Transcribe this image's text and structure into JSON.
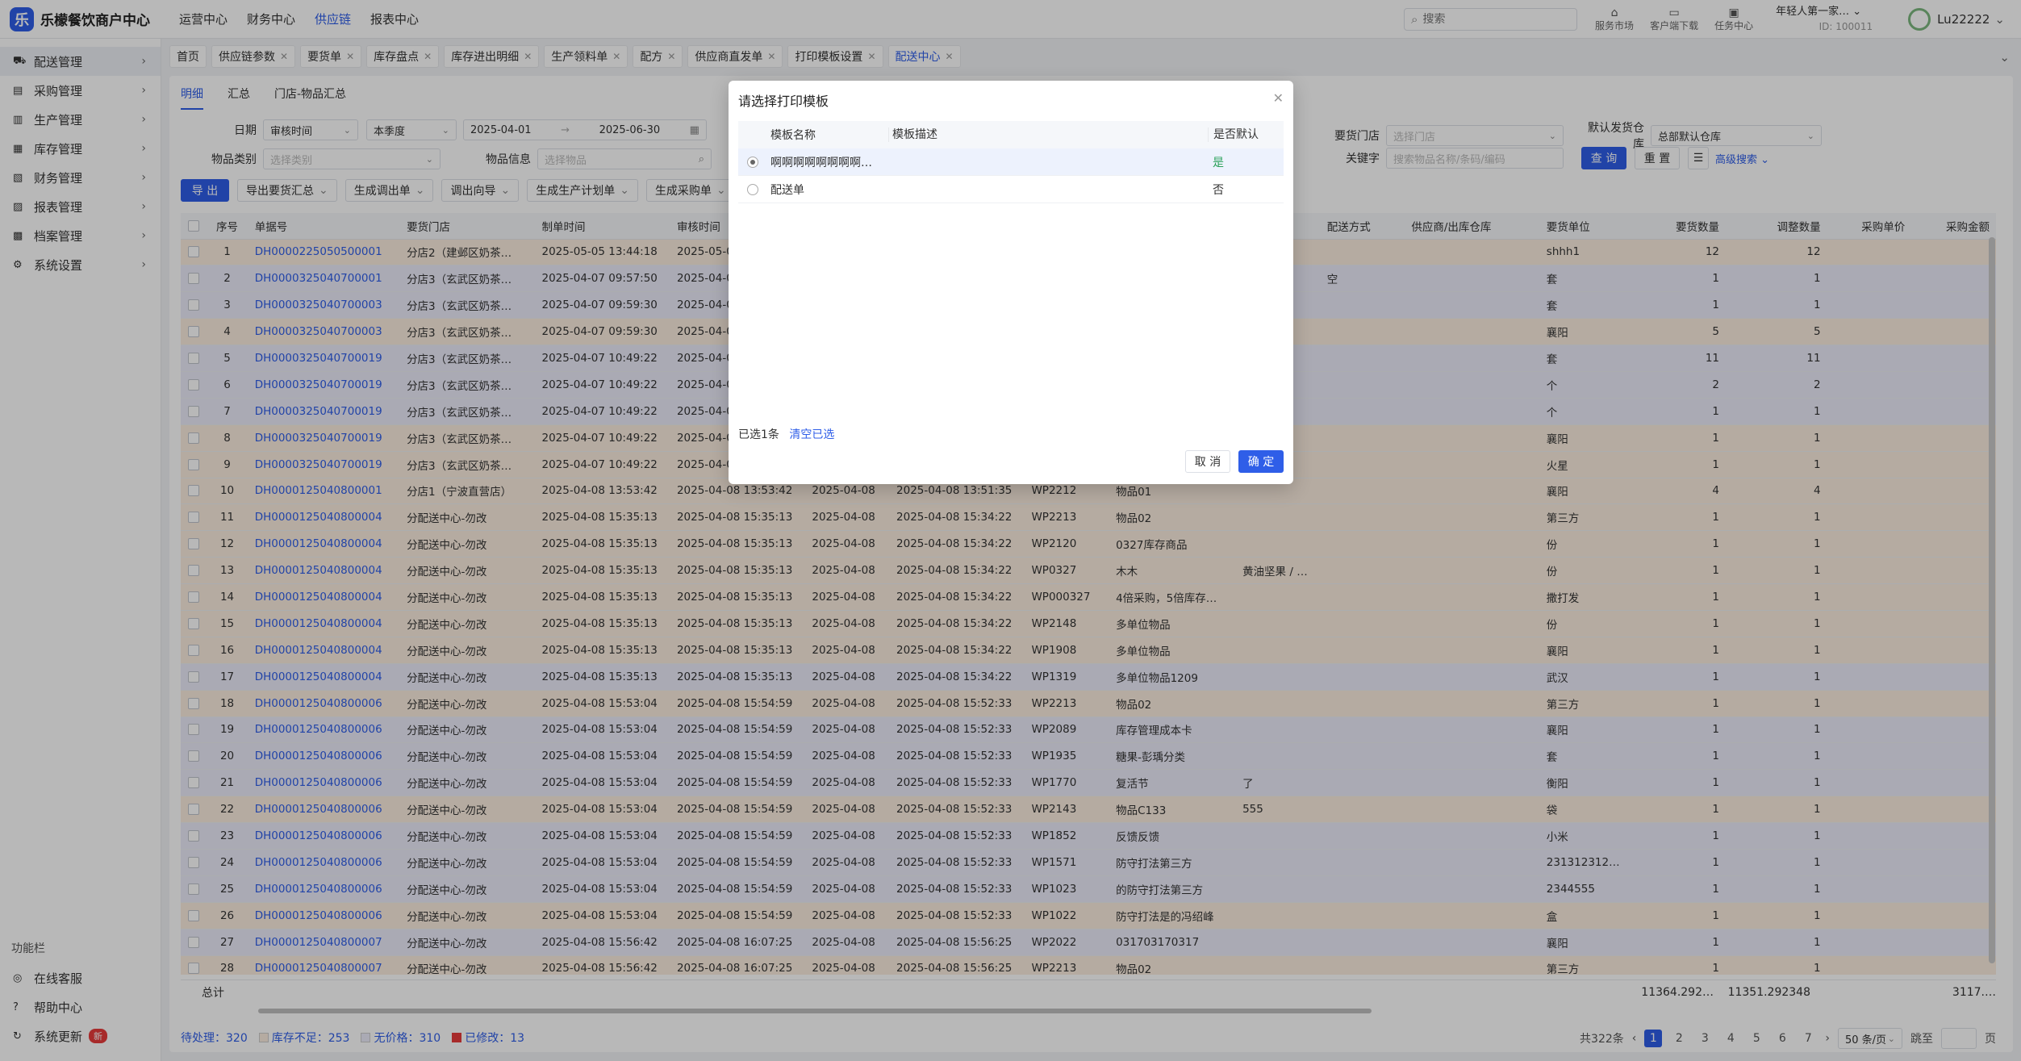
{
  "app": {
    "name": "乐檬餐饮商户中心",
    "logo_glyph": "乐"
  },
  "top_nav": [
    {
      "label": "运营中心",
      "active": false
    },
    {
      "label": "财务中心",
      "active": false
    },
    {
      "label": "供应链",
      "active": true
    },
    {
      "label": "报表中心",
      "active": false
    }
  ],
  "search": {
    "placeholder": "搜索"
  },
  "tools": [
    {
      "icon": "store-icon",
      "label": "服务市场"
    },
    {
      "icon": "folder-icon",
      "label": "客户端下载"
    },
    {
      "icon": "task-icon",
      "label": "任务中心"
    }
  ],
  "store": {
    "name": "年轻人第一家…",
    "id": "ID: 100011"
  },
  "user": {
    "name": "Lu22222"
  },
  "sidebar": {
    "items": [
      {
        "label": "配送管理",
        "icon": "truck-icon",
        "active": true
      },
      {
        "label": "采购管理",
        "icon": "cart-icon",
        "active": false
      },
      {
        "label": "生产管理",
        "icon": "chart-icon",
        "active": false
      },
      {
        "label": "库存管理",
        "icon": "warehouse-icon",
        "active": false
      },
      {
        "label": "财务管理",
        "icon": "finance-icon",
        "active": false
      },
      {
        "label": "报表管理",
        "icon": "report-icon",
        "active": false
      },
      {
        "label": "档案管理",
        "icon": "archive-icon",
        "active": false
      },
      {
        "label": "系统设置",
        "icon": "gear-icon",
        "active": false
      }
    ],
    "bottom_title": "功能栏",
    "bottom_items": [
      {
        "label": "在线客服",
        "icon": "headset-icon"
      },
      {
        "label": "帮助中心",
        "icon": "help-icon"
      },
      {
        "label": "系统更新",
        "icon": "refresh-icon",
        "badge": "新"
      }
    ]
  },
  "tabs": [
    {
      "label": "首页",
      "closable": false
    },
    {
      "label": "供应链参数",
      "closable": true
    },
    {
      "label": "要货单",
      "closable": true
    },
    {
      "label": "库存盘点",
      "closable": true
    },
    {
      "label": "库存进出明细",
      "closable": true
    },
    {
      "label": "生产领料单",
      "closable": true
    },
    {
      "label": "配方",
      "closable": true
    },
    {
      "label": "供应商直发单",
      "closable": true
    },
    {
      "label": "打印模板设置",
      "closable": true
    },
    {
      "label": "配送中心",
      "closable": true,
      "active": true
    }
  ],
  "subtabs": [
    {
      "label": "明细",
      "active": true
    },
    {
      "label": "汇总",
      "active": false
    },
    {
      "label": "门店-物品汇总",
      "active": false
    }
  ],
  "filters": {
    "date_label": "日期",
    "date_type": "审核时间",
    "date_range": "本季度",
    "date_start": "2025-04-01",
    "date_end": "2025-06-30",
    "category_label": "物品类别",
    "category_placeholder": "选择类别",
    "item_label": "物品信息",
    "item_placeholder": "选择物品",
    "store_label": "要货门店",
    "store_placeholder": "选择门店",
    "warehouse_label": "默认发货仓库",
    "warehouse_value": "总部默认仓库",
    "keyword_label": "关键字",
    "keyword_placeholder": "搜索物品名称/条码/编码",
    "query": "查 询",
    "reset": "重 置",
    "advanced": "高级搜索"
  },
  "actions": [
    {
      "label": "导 出",
      "primary": true
    },
    {
      "label": "导出要货汇总",
      "dropdown": true
    },
    {
      "label": "生成调出单",
      "dropdown": true
    },
    {
      "label": "调出向导",
      "dropdown": true
    },
    {
      "label": "生成生产计划单",
      "dropdown": true
    },
    {
      "label": "生成采购单",
      "dropdown": true
    }
  ],
  "table": {
    "columns": {
      "seq": "序号",
      "no": "单据号",
      "store": "要货门店",
      "created": "制单时间",
      "audited": "审核时间",
      "ship": "配送方式",
      "supplier": "供应商/出库仓库",
      "unit": "要货单位",
      "qty": "要货数量",
      "adj": "调整数量",
      "price": "采购单价",
      "amount": "采购金额",
      "col_set": "列"
    },
    "rows": [
      {
        "seq": "1",
        "no": "DH0000225050500001",
        "store": "分店2（建邺区奶茶…",
        "created": "2025-05-05 13:44:18",
        "audited": "2025-05-05",
        "d2": "",
        "t2": "",
        "code": "",
        "item": "",
        "spec": "",
        "ship": "",
        "unit": "shhh1",
        "qty": "12",
        "adj": "12",
        "c": "y"
      },
      {
        "seq": "2",
        "no": "DH0000325040700001",
        "store": "分店3（玄武区奶茶…",
        "created": "2025-04-07 09:57:50",
        "audited": "2025-04-07",
        "d2": "",
        "t2": "",
        "code": "",
        "item": "",
        "spec": "",
        "ship": "空",
        "unit": "套",
        "qty": "1",
        "adj": "1",
        "c": "p"
      },
      {
        "seq": "3",
        "no": "DH0000325040700003",
        "store": "分店3（玄武区奶茶…",
        "created": "2025-04-07 09:59:30",
        "audited": "2025-04-07",
        "d2": "",
        "t2": "",
        "code": "",
        "item": "",
        "spec": "",
        "ship": "",
        "unit": "套",
        "qty": "1",
        "adj": "1",
        "c": "p"
      },
      {
        "seq": "4",
        "no": "DH0000325040700003",
        "store": "分店3（玄武区奶茶…",
        "created": "2025-04-07 09:59:30",
        "audited": "2025-04-07",
        "d2": "",
        "t2": "",
        "code": "",
        "item": "",
        "spec": "",
        "ship": "",
        "unit": "襄阳",
        "qty": "5",
        "adj": "5",
        "c": "y"
      },
      {
        "seq": "5",
        "no": "DH0000325040700019",
        "store": "分店3（玄武区奶茶…",
        "created": "2025-04-07 10:49:22",
        "audited": "2025-04-07",
        "d2": "",
        "t2": "",
        "code": "",
        "item": "",
        "spec": "",
        "ship": "",
        "unit": "套",
        "qty": "11",
        "adj": "11",
        "c": "p"
      },
      {
        "seq": "6",
        "no": "DH0000325040700019",
        "store": "分店3（玄武区奶茶…",
        "created": "2025-04-07 10:49:22",
        "audited": "2025-04-07",
        "d2": "",
        "t2": "",
        "code": "",
        "item": "",
        "spec": "",
        "ship": "",
        "unit": "个",
        "qty": "2",
        "adj": "2",
        "c": "p"
      },
      {
        "seq": "7",
        "no": "DH0000325040700019",
        "store": "分店3（玄武区奶茶…",
        "created": "2025-04-07 10:49:22",
        "audited": "2025-04-07",
        "d2": "",
        "t2": "",
        "code": "",
        "item": "",
        "spec": "",
        "ship": "",
        "unit": "个",
        "qty": "1",
        "adj": "1",
        "c": "p"
      },
      {
        "seq": "8",
        "no": "DH0000325040700019",
        "store": "分店3（玄武区奶茶…",
        "created": "2025-04-07 10:49:22",
        "audited": "2025-04-07",
        "d2": "",
        "t2": "",
        "code": "",
        "item": "",
        "spec": "",
        "ship": "",
        "unit": "襄阳",
        "qty": "1",
        "adj": "1",
        "c": "y"
      },
      {
        "seq": "9",
        "no": "DH0000325040700019",
        "store": "分店3（玄武区奶茶…",
        "created": "2025-04-07 10:49:22",
        "audited": "2025-04-07",
        "d2": "",
        "t2": "",
        "code": "",
        "item": "",
        "spec": "",
        "ship": "",
        "unit": "火星",
        "qty": "1",
        "adj": "1",
        "c": "y"
      },
      {
        "seq": "10",
        "no": "DH0000125040800001",
        "store": "分店1（宁波直营店）",
        "created": "2025-04-08 13:53:42",
        "audited": "2025-04-08 13:53:42",
        "d2": "2025-04-08",
        "t2": "2025-04-08 13:51:35",
        "code": "WP2212",
        "item": "物品01",
        "spec": "",
        "ship": "",
        "unit": "襄阳",
        "qty": "4",
        "adj": "4",
        "c": "y"
      },
      {
        "seq": "11",
        "no": "DH0000125040800004",
        "store": "分配送中心-勿改",
        "created": "2025-04-08 15:35:13",
        "audited": "2025-04-08 15:35:13",
        "d2": "2025-04-08",
        "t2": "2025-04-08 15:34:22",
        "code": "WP2213",
        "item": "物品02",
        "spec": "",
        "ship": "",
        "unit": "第三方",
        "qty": "1",
        "adj": "1",
        "c": "y"
      },
      {
        "seq": "12",
        "no": "DH0000125040800004",
        "store": "分配送中心-勿改",
        "created": "2025-04-08 15:35:13",
        "audited": "2025-04-08 15:35:13",
        "d2": "2025-04-08",
        "t2": "2025-04-08 15:34:22",
        "code": "WP2120",
        "item": "0327库存商品",
        "spec": "",
        "ship": "",
        "unit": "份",
        "qty": "1",
        "adj": "1",
        "c": "y"
      },
      {
        "seq": "13",
        "no": "DH0000125040800004",
        "store": "分配送中心-勿改",
        "created": "2025-04-08 15:35:13",
        "audited": "2025-04-08 15:35:13",
        "d2": "2025-04-08",
        "t2": "2025-04-08 15:34:22",
        "code": "WP0327",
        "item": "木木",
        "spec": "黄油坚果 / 47…",
        "ship": "",
        "unit": "份",
        "qty": "1",
        "adj": "1",
        "c": "y"
      },
      {
        "seq": "14",
        "no": "DH0000125040800004",
        "store": "分配送中心-勿改",
        "created": "2025-04-08 15:35:13",
        "audited": "2025-04-08 15:35:13",
        "d2": "2025-04-08",
        "t2": "2025-04-08 15:34:22",
        "code": "WP000327",
        "item": "4倍采购，5倍库存…",
        "spec": "",
        "ship": "",
        "unit": "撒打发",
        "qty": "1",
        "adj": "1",
        "c": "y"
      },
      {
        "seq": "15",
        "no": "DH0000125040800004",
        "store": "分配送中心-勿改",
        "created": "2025-04-08 15:35:13",
        "audited": "2025-04-08 15:35:13",
        "d2": "2025-04-08",
        "t2": "2025-04-08 15:34:22",
        "code": "WP2148",
        "item": "多单位物品",
        "spec": "",
        "ship": "",
        "unit": "份",
        "qty": "1",
        "adj": "1",
        "c": "y"
      },
      {
        "seq": "16",
        "no": "DH0000125040800004",
        "store": "分配送中心-勿改",
        "created": "2025-04-08 15:35:13",
        "audited": "2025-04-08 15:35:13",
        "d2": "2025-04-08",
        "t2": "2025-04-08 15:34:22",
        "code": "WP1908",
        "item": "多单位物品",
        "spec": "",
        "ship": "",
        "unit": "襄阳",
        "qty": "1",
        "adj": "1",
        "c": "y"
      },
      {
        "seq": "17",
        "no": "DH0000125040800004",
        "store": "分配送中心-勿改",
        "created": "2025-04-08 15:35:13",
        "audited": "2025-04-08 15:35:13",
        "d2": "2025-04-08",
        "t2": "2025-04-08 15:34:22",
        "code": "WP1319",
        "item": "多单位物品1209",
        "spec": "",
        "ship": "",
        "unit": "武汉",
        "qty": "1",
        "adj": "1",
        "c": "p"
      },
      {
        "seq": "18",
        "no": "DH0000125040800006",
        "store": "分配送中心-勿改",
        "created": "2025-04-08 15:53:04",
        "audited": "2025-04-08 15:54:59",
        "d2": "2025-04-08",
        "t2": "2025-04-08 15:52:33",
        "code": "WP2213",
        "item": "物品02",
        "spec": "",
        "ship": "",
        "unit": "第三方",
        "qty": "1",
        "adj": "1",
        "c": "y"
      },
      {
        "seq": "19",
        "no": "DH0000125040800006",
        "store": "分配送中心-勿改",
        "created": "2025-04-08 15:53:04",
        "audited": "2025-04-08 15:54:59",
        "d2": "2025-04-08",
        "t2": "2025-04-08 15:52:33",
        "code": "WP2089",
        "item": "库存管理成本卡",
        "spec": "",
        "ship": "",
        "unit": "襄阳",
        "qty": "1",
        "adj": "1",
        "c": "p"
      },
      {
        "seq": "20",
        "no": "DH0000125040800006",
        "store": "分配送中心-勿改",
        "created": "2025-04-08 15:53:04",
        "audited": "2025-04-08 15:54:59",
        "d2": "2025-04-08",
        "t2": "2025-04-08 15:52:33",
        "code": "WP1935",
        "item": "糖果-彭瑀分类",
        "spec": "",
        "ship": "",
        "unit": "套",
        "qty": "1",
        "adj": "1",
        "c": "p"
      },
      {
        "seq": "21",
        "no": "DH0000125040800006",
        "store": "分配送中心-勿改",
        "created": "2025-04-08 15:53:04",
        "audited": "2025-04-08 15:54:59",
        "d2": "2025-04-08",
        "t2": "2025-04-08 15:52:33",
        "code": "WP1770",
        "item": "复活节",
        "spec": "了",
        "ship": "",
        "unit": "衡阳",
        "qty": "1",
        "adj": "1",
        "c": "p"
      },
      {
        "seq": "22",
        "no": "DH0000125040800006",
        "store": "分配送中心-勿改",
        "created": "2025-04-08 15:53:04",
        "audited": "2025-04-08 15:54:59",
        "d2": "2025-04-08",
        "t2": "2025-04-08 15:52:33",
        "code": "WP2143",
        "item": "物品C133",
        "spec": "555",
        "ship": "",
        "unit": "袋",
        "qty": "1",
        "adj": "1",
        "c": "y"
      },
      {
        "seq": "23",
        "no": "DH0000125040800006",
        "store": "分配送中心-勿改",
        "created": "2025-04-08 15:53:04",
        "audited": "2025-04-08 15:54:59",
        "d2": "2025-04-08",
        "t2": "2025-04-08 15:52:33",
        "code": "WP1852",
        "item": "反馈反馈",
        "spec": "",
        "ship": "",
        "unit": "小米",
        "qty": "1",
        "adj": "1",
        "c": "p"
      },
      {
        "seq": "24",
        "no": "DH0000125040800006",
        "store": "分配送中心-勿改",
        "created": "2025-04-08 15:53:04",
        "audited": "2025-04-08 15:54:59",
        "d2": "2025-04-08",
        "t2": "2025-04-08 15:52:33",
        "code": "WP1571",
        "item": "防守打法第三方",
        "spec": "",
        "ship": "",
        "unit": "231312312…",
        "qty": "1",
        "adj": "1",
        "c": "p"
      },
      {
        "seq": "25",
        "no": "DH0000125040800006",
        "store": "分配送中心-勿改",
        "created": "2025-04-08 15:53:04",
        "audited": "2025-04-08 15:54:59",
        "d2": "2025-04-08",
        "t2": "2025-04-08 15:52:33",
        "code": "WP1023",
        "item": "的防守打法第三方",
        "spec": "",
        "ship": "",
        "unit": "2344555",
        "qty": "1",
        "adj": "1",
        "c": "p"
      },
      {
        "seq": "26",
        "no": "DH0000125040800006",
        "store": "分配送中心-勿改",
        "created": "2025-04-08 15:53:04",
        "audited": "2025-04-08 15:54:59",
        "d2": "2025-04-08",
        "t2": "2025-04-08 15:52:33",
        "code": "WP1022",
        "item": "防守打法是的冯绍峰",
        "spec": "",
        "ship": "",
        "unit": "盒",
        "qty": "1",
        "adj": "1",
        "c": "y"
      },
      {
        "seq": "27",
        "no": "DH0000125040800007",
        "store": "分配送中心-勿改",
        "created": "2025-04-08 15:56:42",
        "audited": "2025-04-08 16:07:25",
        "d2": "2025-04-08",
        "t2": "2025-04-08 15:56:25",
        "code": "WP2022",
        "item": "031703170317",
        "spec": "",
        "ship": "",
        "unit": "襄阳",
        "qty": "1",
        "adj": "1",
        "c": "p"
      },
      {
        "seq": "28",
        "no": "DH0000125040800007",
        "store": "分配送中心-勿改",
        "created": "2025-04-08 15:56:42",
        "audited": "2025-04-08 16:07:25",
        "d2": "2025-04-08",
        "t2": "2025-04-08 15:56:25",
        "code": "WP2213",
        "item": "物品02",
        "spec": "",
        "ship": "",
        "unit": "第三方",
        "qty": "1",
        "adj": "1",
        "c": "y"
      }
    ],
    "total_label": "总计",
    "total_qty": "11364.292…",
    "total_adj": "11351.292348",
    "total_amount": "3117.…"
  },
  "footer": {
    "pending_label": "待处理：",
    "pending_value": "320",
    "short_label": "库存不足：",
    "short_value": "253",
    "noprice_label": "无价格：",
    "noprice_value": "310",
    "modified_label": "已修改：",
    "modified_value": "13",
    "total_text": "共322条",
    "pages": [
      "1",
      "2",
      "3",
      "4",
      "5",
      "6",
      "7"
    ],
    "page_size": "50 条/页",
    "goto": "跳至",
    "page_unit": "页"
  },
  "modal": {
    "title": "请选择打印模板",
    "col_name": "模板名称",
    "col_desc": "模板描述",
    "col_default": "是否默认",
    "rows": [
      {
        "name": "啊啊啊啊啊啊啊啊…",
        "desc": "",
        "default": "是",
        "selected": true
      },
      {
        "name": "配送单",
        "desc": "",
        "default": "否",
        "selected": false
      }
    ],
    "selected_text": "已选1条",
    "clear_text": "清空已选",
    "cancel": "取 消",
    "ok": "确 定"
  },
  "colors": {
    "primary": "#2f5ee8",
    "row_yellow": "#fbeee0",
    "row_purple": "#ececfa",
    "overlay": "rgba(0,0,0,0.28)"
  }
}
